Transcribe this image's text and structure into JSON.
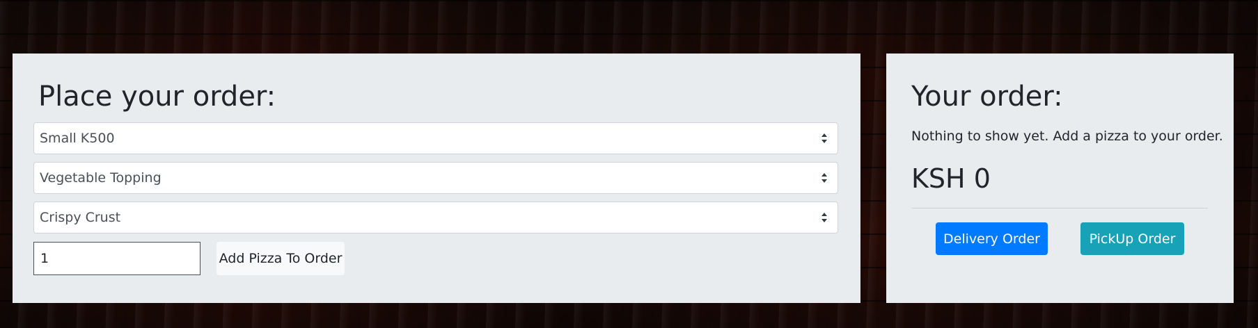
{
  "order_form": {
    "heading": "Place your order:",
    "size_select": {
      "selected": "Small K500"
    },
    "topping_select": {
      "selected": "Vegetable Topping"
    },
    "crust_select": {
      "selected": "Crispy Crust"
    },
    "quantity_input": {
      "value": "1"
    },
    "add_button_label": "Add Pizza To Order"
  },
  "order_summary": {
    "heading": "Your order:",
    "empty_message": "Nothing to show yet. Add a pizza to your order.",
    "total": "KSH 0",
    "delivery_button_label": "Delivery Order",
    "pickup_button_label": "PickUp Order"
  },
  "colors": {
    "panel_background": "#e9ecef",
    "delivery_button": "#007bff",
    "pickup_button": "#17a2b8"
  },
  "icons": {
    "select_arrows": "sort-updown-icon"
  }
}
